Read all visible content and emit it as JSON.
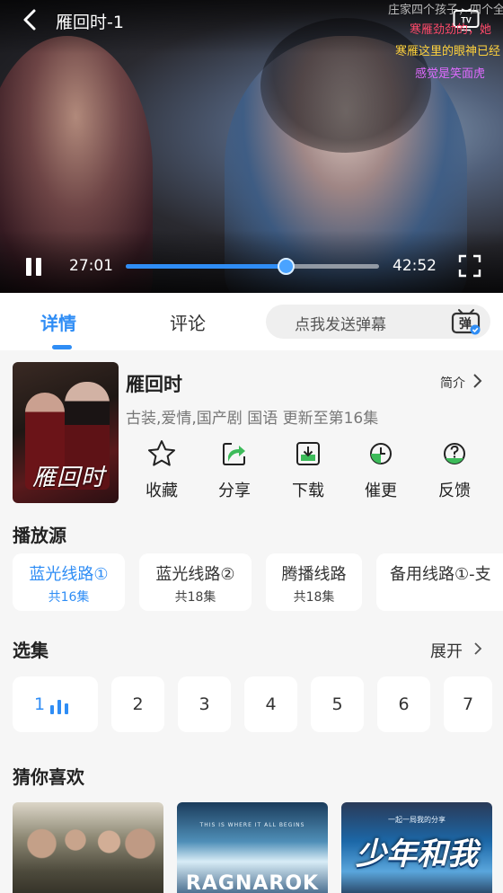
{
  "player": {
    "title": "雁回时-1",
    "current_time": "27:01",
    "total_time": "42:52",
    "progress": 0.63,
    "danmaku": [
      "庄家四个孩子，四个全",
      "寒雁劲劲的，她",
      "寒雁这里的眼神已经",
      "感觉是笑面虎"
    ]
  },
  "tabs": {
    "detail": "详情",
    "comment": "评论",
    "danmaku_placeholder": "点我发送弹幕",
    "danmaku_button_text": "弹"
  },
  "show": {
    "poster_text": "雁回时",
    "title": "雁回时",
    "intro_label": "简介",
    "meta": "古装,爱情,国产剧 国语 更新至第16集",
    "actions": [
      {
        "label": "收藏",
        "icon": "star-icon"
      },
      {
        "label": "分享",
        "icon": "share-icon"
      },
      {
        "label": "下载",
        "icon": "download-icon"
      },
      {
        "label": "催更",
        "icon": "clock-icon"
      },
      {
        "label": "反馈",
        "icon": "feedback-icon"
      }
    ]
  },
  "sources": {
    "heading": "播放源",
    "items": [
      {
        "name": "蓝光线路①",
        "count": "共16集"
      },
      {
        "name": "蓝光线路②",
        "count": "共18集"
      },
      {
        "name": "腾播线路",
        "count": "共18集"
      },
      {
        "name": "备用线路①-支",
        "count": ""
      }
    ]
  },
  "episodes": {
    "heading": "选集",
    "expand_label": "展开",
    "items": [
      "1",
      "2",
      "3",
      "4",
      "5",
      "6",
      "7"
    ]
  },
  "recommend": {
    "heading": "猜你喜欢",
    "items": [
      {
        "art_text": ""
      },
      {
        "art_tagline": "THIS IS WHERE IT ALL BEGINS",
        "art_text": "RAGNAROK"
      },
      {
        "art_tagline": "一起一局我的分享",
        "art_text": "少年和我"
      }
    ]
  },
  "colors": {
    "accent": "#2f8df5",
    "danmaku_red": "#ff4a6a",
    "danmaku_yellow": "#ffd23c",
    "danmaku_purple": "#e06bff"
  }
}
